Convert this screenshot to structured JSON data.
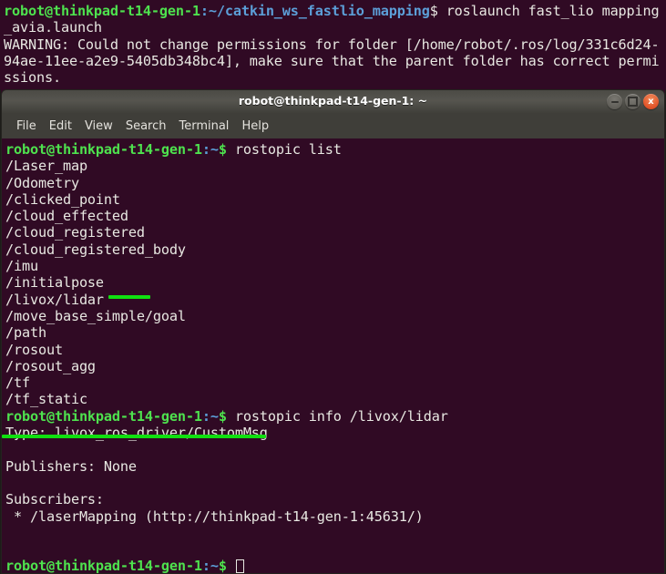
{
  "background_terminal": {
    "lines": [
      {
        "segments": [
          {
            "text": "robot@thinkpad-t14-gen-1",
            "style": "g"
          },
          {
            "text": ":",
            "style": "b"
          },
          {
            "text": "~/catkin_ws_fastlio_mapping",
            "style": "b"
          },
          {
            "text": "$ roslaunch fast_lio mapping",
            "style": "w"
          }
        ]
      },
      {
        "segments": [
          {
            "text": "_avia.launch",
            "style": "w"
          }
        ]
      },
      {
        "segments": [
          {
            "text": "WARNING: Could not change permissions for folder [/home/robot/.ros/log/331c6d24-",
            "style": "w"
          }
        ]
      },
      {
        "segments": [
          {
            "text": "94ae-11ee-a2e9-5405db348bc4], make sure that the parent folder has correct permi",
            "style": "w"
          }
        ]
      },
      {
        "segments": [
          {
            "text": "ssions.",
            "style": "w"
          }
        ]
      }
    ]
  },
  "window": {
    "title": "robot@thinkpad-t14-gen-1: ~",
    "buttons": [
      {
        "name": "minimize-button",
        "icon": "minimize-icon",
        "label": ""
      },
      {
        "name": "maximize-button",
        "icon": "maximize-icon",
        "label": ""
      },
      {
        "name": "close-button",
        "icon": "close-icon",
        "label": "x"
      }
    ],
    "menu": [
      "File",
      "Edit",
      "View",
      "Search",
      "Terminal",
      "Help"
    ]
  },
  "terminal": {
    "prompt_user_host": "robot@thinkpad-t14-gen-1",
    "prompt_colon": ":",
    "prompt_path": "~",
    "prompt_dollar": "$ ",
    "lines": [
      {
        "type": "prompt",
        "command": "rostopic list"
      },
      {
        "type": "out",
        "text": "/Laser_map"
      },
      {
        "type": "out",
        "text": "/Odometry"
      },
      {
        "type": "out",
        "text": "/clicked_point"
      },
      {
        "type": "out",
        "text": "/cloud_effected"
      },
      {
        "type": "out",
        "text": "/cloud_registered"
      },
      {
        "type": "out",
        "text": "/cloud_registered_body"
      },
      {
        "type": "out",
        "text": "/imu"
      },
      {
        "type": "out",
        "text": "/initialpose"
      },
      {
        "type": "out",
        "text": "/livox/lidar"
      },
      {
        "type": "out",
        "text": "/move_base_simple/goal"
      },
      {
        "type": "out",
        "text": "/path"
      },
      {
        "type": "out",
        "text": "/rosout"
      },
      {
        "type": "out",
        "text": "/rosout_agg"
      },
      {
        "type": "out",
        "text": "/tf"
      },
      {
        "type": "out",
        "text": "/tf_static"
      },
      {
        "type": "prompt",
        "command": "rostopic info /livox/lidar"
      },
      {
        "type": "out",
        "text": "Type: livox_ros_driver/CustomMsg"
      },
      {
        "type": "out",
        "text": ""
      },
      {
        "type": "out",
        "text": "Publishers: None"
      },
      {
        "type": "out",
        "text": ""
      },
      {
        "type": "out",
        "text": "Subscribers:"
      },
      {
        "type": "out",
        "text": " * /laserMapping (http://thinkpad-t14-gen-1:45631/)"
      },
      {
        "type": "out",
        "text": ""
      },
      {
        "type": "out",
        "text": ""
      },
      {
        "type": "prompt-cursor",
        "command": ""
      }
    ]
  },
  "annotations": [
    {
      "name": "highlight-livox-lidar",
      "target": "/livox/lidar",
      "color": "#10e010"
    },
    {
      "name": "highlight-type-custommsg",
      "target": "Type: livox_ros_driver/CustomMsg",
      "color": "#10e010"
    }
  ],
  "colors": {
    "terminal_bg": "#300a24",
    "prompt_green": "#4ee24e",
    "path_blue": "#5c9fd8",
    "text_white": "#e8e8e2",
    "annotation_green": "#10e010",
    "titlebar": "#4b4a45",
    "menubar": "#3f3e39"
  }
}
